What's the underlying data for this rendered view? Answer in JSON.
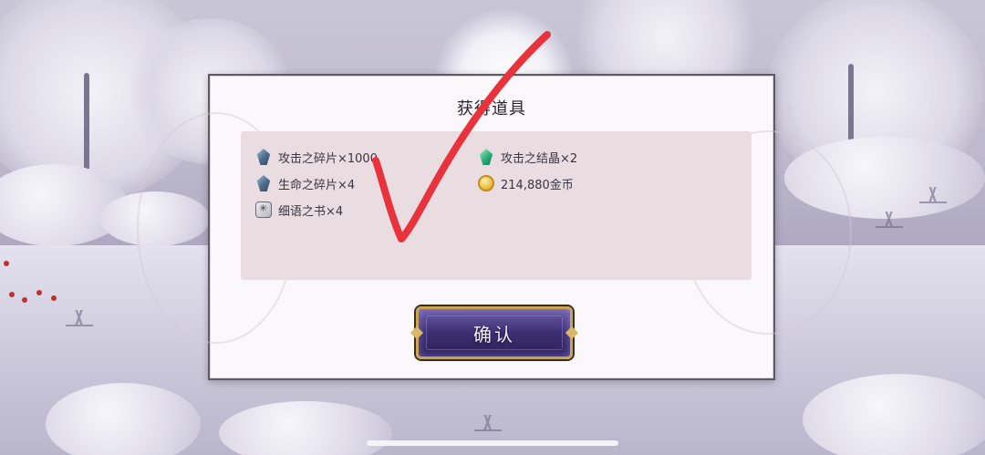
{
  "dialog": {
    "title": "获得道具",
    "confirm_label": "确认"
  },
  "rewards": [
    {
      "icon": "attack-shard-icon",
      "label": "攻击之碎片×1000"
    },
    {
      "icon": "life-shard-icon",
      "label": "生命之碎片×4"
    },
    {
      "icon": "whisper-book-icon",
      "label": "细语之书×4"
    },
    {
      "icon": "attack-crystal-icon",
      "label": "攻击之结晶×2"
    },
    {
      "icon": "gold-coin-icon",
      "label": "214,880金币"
    }
  ],
  "colors": {
    "checkmark": "#e8323c",
    "button_gold": "#c9a455",
    "button_purple": "#3c2f72",
    "panel": "#e9dde2"
  }
}
